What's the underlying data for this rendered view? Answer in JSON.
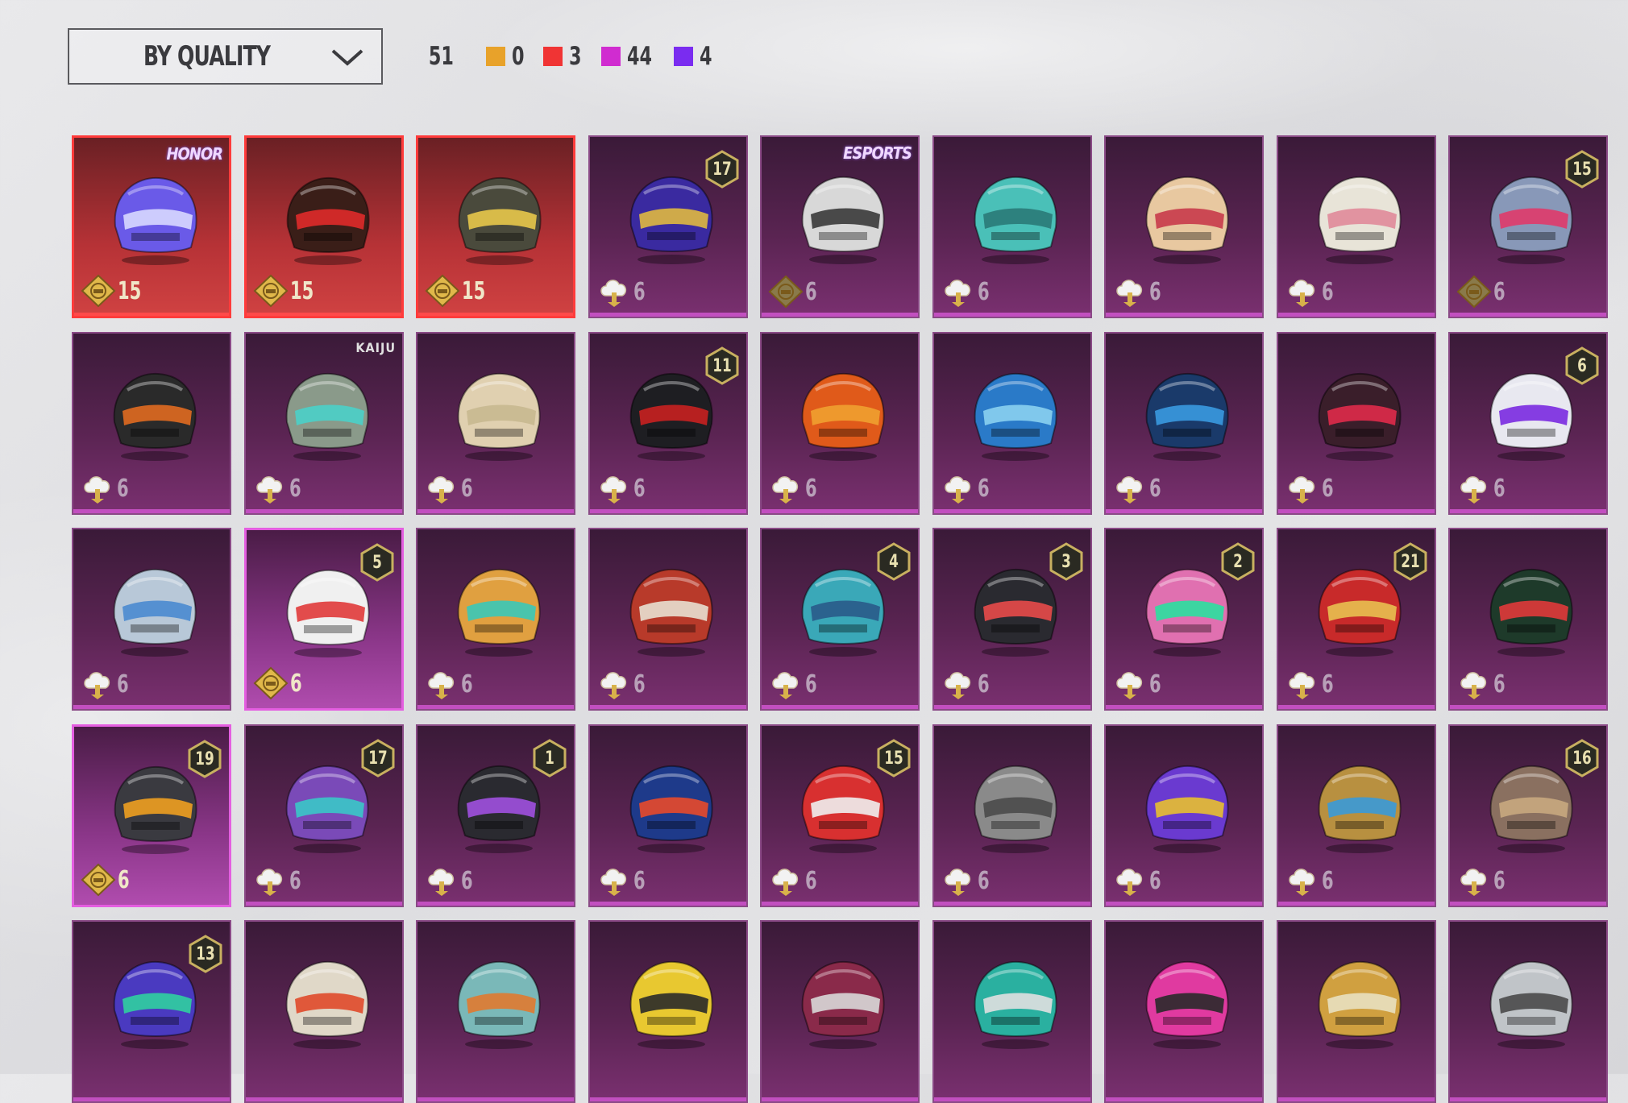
{
  "filter": {
    "sort_label": "BY QUALITY",
    "icon": "chevron-down-icon"
  },
  "counters": {
    "total": "51",
    "items": [
      {
        "color": "#e8a22a",
        "value": "0",
        "name": "gold-count"
      },
      {
        "color": "#f03434",
        "value": "3",
        "name": "red-count"
      },
      {
        "color": "#d02cd0",
        "value": "44",
        "name": "pink-count"
      },
      {
        "color": "#7a2cf0",
        "value": "4",
        "name": "purple-count"
      }
    ]
  },
  "colors": {
    "gold_currency": "#d8b24a",
    "ag_currency": "#f2f2f2",
    "badge_gold": "#c8b060"
  },
  "helmets": [
    {
      "rarity": "red",
      "cost": "15",
      "currency": "gold",
      "brand": "HONOR",
      "helm": "#6a5ae8",
      "accent": "#d8d8ff"
    },
    {
      "rarity": "red",
      "cost": "15",
      "currency": "gold",
      "helm": "#3a1e18",
      "accent": "#e02a2a"
    },
    {
      "rarity": "red",
      "cost": "15",
      "currency": "gold",
      "helm": "#4a4a3c",
      "accent": "#e8c84a"
    },
    {
      "rarity": "purple",
      "cost": "6",
      "currency": "ag",
      "badge": "17",
      "helm": "#3a2aa0",
      "accent": "#e0b840"
    },
    {
      "rarity": "purple",
      "cost": "6",
      "currency": "gold-dim",
      "brand": "ESPORTS",
      "helm": "#d8d8d8",
      "accent": "#3a3a3a"
    },
    {
      "rarity": "purple",
      "cost": "6",
      "currency": "ag",
      "helm": "#4ac0b8",
      "accent": "#2a7a78"
    },
    {
      "rarity": "purple",
      "cost": "6",
      "currency": "ag",
      "helm": "#e8c8a0",
      "accent": "#c83a4a"
    },
    {
      "rarity": "purple",
      "cost": "6",
      "currency": "ag",
      "helm": "#e8e4d8",
      "accent": "#e08a9a"
    },
    {
      "rarity": "purple",
      "cost": "6",
      "currency": "gold-dim",
      "badge": "15",
      "helm": "#8898b8",
      "accent": "#e03a6a"
    },
    {
      "rarity": "purple",
      "cost": "6",
      "currency": "ag",
      "helm": "#2a2a2a",
      "accent": "#e06a20"
    },
    {
      "rarity": "purple",
      "cost": "6",
      "currency": "ag",
      "brand": "KAIJU",
      "helm": "#8a9a8a",
      "accent": "#4ad0c8"
    },
    {
      "rarity": "purple",
      "cost": "6",
      "currency": "ag",
      "helm": "#e0d0b0",
      "accent": "#c8b890"
    },
    {
      "rarity": "purple",
      "cost": "6",
      "currency": "ag",
      "badge": "11",
      "helm": "#1e1e22",
      "accent": "#c82020"
    },
    {
      "rarity": "purple",
      "cost": "6",
      "currency": "ag",
      "helm": "#e05a1a",
      "accent": "#f0a030"
    },
    {
      "rarity": "purple",
      "cost": "6",
      "currency": "ag",
      "helm": "#2a7ac8",
      "accent": "#8ad0f0"
    },
    {
      "rarity": "purple",
      "cost": "6",
      "currency": "ag",
      "helm": "#1a3a6a",
      "accent": "#3a9ae0"
    },
    {
      "rarity": "purple",
      "cost": "6",
      "currency": "ag",
      "helm": "#3a1e2a",
      "accent": "#e02a4a"
    },
    {
      "rarity": "purple",
      "cost": "6",
      "currency": "ag",
      "badge": "6",
      "helm": "#e8e8f0",
      "accent": "#7a2ae0"
    },
    {
      "rarity": "purple",
      "cost": "6",
      "currency": "ag",
      "helm": "#b8c8d8",
      "accent": "#4a8ad0"
    },
    {
      "rarity": "pink",
      "cost": "6",
      "currency": "gold",
      "badge": "5",
      "helm": "#f0f0f0",
      "accent": "#e03a3a"
    },
    {
      "rarity": "purple",
      "cost": "6",
      "currency": "ag",
      "helm": "#e0a040",
      "accent": "#3ac8b8"
    },
    {
      "rarity": "purple",
      "cost": "6",
      "currency": "ag",
      "helm": "#b83a2a",
      "accent": "#e8e0d0"
    },
    {
      "rarity": "purple",
      "cost": "6",
      "currency": "ag",
      "badge": "4",
      "helm": "#3aa8b8",
      "accent": "#2a5a8a"
    },
    {
      "rarity": "purple",
      "cost": "6",
      "currency": "ag",
      "badge": "3",
      "helm": "#2a2a30",
      "accent": "#e84a4a"
    },
    {
      "rarity": "purple",
      "cost": "6",
      "currency": "ag",
      "badge": "2",
      "helm": "#e070b0",
      "accent": "#2ae0a0"
    },
    {
      "rarity": "purple",
      "cost": "6",
      "currency": "ag",
      "badge": "21",
      "helm": "#c82a2a",
      "accent": "#e8c050"
    },
    {
      "rarity": "purple",
      "cost": "6",
      "currency": "ag",
      "helm": "#1e3a2a",
      "accent": "#e03a3a"
    },
    {
      "rarity": "pink",
      "cost": "6",
      "currency": "gold",
      "badge": "19",
      "helm": "#3a3a40",
      "accent": "#f0a020"
    },
    {
      "rarity": "purple",
      "cost": "6",
      "currency": "ag",
      "badge": "17",
      "helm": "#7a4ab8",
      "accent": "#3ac8c8"
    },
    {
      "rarity": "purple",
      "cost": "6",
      "currency": "ag",
      "badge": "1",
      "helm": "#2a2a30",
      "accent": "#a050e0"
    },
    {
      "rarity": "purple",
      "cost": "6",
      "currency": "ag",
      "helm": "#1e3a8a",
      "accent": "#e84a2a"
    },
    {
      "rarity": "purple",
      "cost": "6",
      "currency": "ag",
      "badge": "15",
      "helm": "#d83030",
      "accent": "#f0f0f0"
    },
    {
      "rarity": "purple",
      "cost": "6",
      "currency": "ag",
      "helm": "#8a8a8a",
      "accent": "#4a4a4a"
    },
    {
      "rarity": "purple",
      "cost": "6",
      "currency": "ag",
      "helm": "#6a3ad0",
      "accent": "#e8c030"
    },
    {
      "rarity": "purple",
      "cost": "6",
      "currency": "ag",
      "helm": "#b89040",
      "accent": "#3a9ad8"
    },
    {
      "rarity": "purple",
      "cost": "6",
      "currency": "ag",
      "badge": "16",
      "helm": "#8a7060",
      "accent": "#c8a880"
    },
    {
      "rarity": "purple",
      "cost": "",
      "currency": "",
      "badge": "13",
      "helm": "#4a3ac0",
      "accent": "#30d0a0"
    },
    {
      "rarity": "purple",
      "cost": "",
      "currency": "",
      "helm": "#e0d8c8",
      "accent": "#e04a2a"
    },
    {
      "rarity": "purple",
      "cost": "",
      "currency": "",
      "helm": "#7ab8b8",
      "accent": "#e07a30"
    },
    {
      "rarity": "purple",
      "cost": "",
      "currency": "",
      "helm": "#e8c830",
      "accent": "#2a2a2a"
    },
    {
      "rarity": "purple",
      "cost": "",
      "currency": "",
      "helm": "#8a2a4a",
      "accent": "#d8d8d8"
    },
    {
      "rarity": "purple",
      "cost": "",
      "currency": "",
      "helm": "#2ab0a0",
      "accent": "#e0e0e0"
    },
    {
      "rarity": "purple",
      "cost": "",
      "currency": "",
      "helm": "#e03aa0",
      "accent": "#2a2a2a"
    },
    {
      "rarity": "purple",
      "cost": "",
      "currency": "",
      "helm": "#d0a040",
      "accent": "#e8e0c0"
    },
    {
      "rarity": "purple",
      "cost": "",
      "currency": "",
      "helm": "#c0c4c8",
      "accent": "#4a4a4a"
    }
  ]
}
